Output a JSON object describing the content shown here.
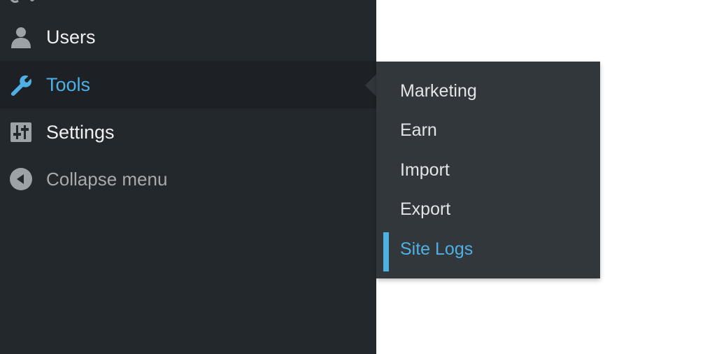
{
  "sidebar": {
    "items": [
      {
        "label": "Users",
        "icon": "user-icon"
      },
      {
        "label": "Tools",
        "icon": "wrench-icon",
        "active": true
      },
      {
        "label": "Settings",
        "icon": "sliders-icon"
      }
    ],
    "collapse_label": "Collapse menu",
    "collapse_icon": "collapse-arrow-icon"
  },
  "submenu": {
    "items": [
      {
        "label": "Marketing"
      },
      {
        "label": "Earn"
      },
      {
        "label": "Import"
      },
      {
        "label": "Export"
      },
      {
        "label": "Site Logs",
        "current": true
      }
    ]
  },
  "colors": {
    "sidebar_bg": "#23282d",
    "active_bg": "#1d2125",
    "submenu_bg": "#32373c",
    "accent": "#4fb0e5",
    "text": "#f0f0f1",
    "muted_text": "#a7aaad",
    "icon": "#9ca2a7"
  }
}
